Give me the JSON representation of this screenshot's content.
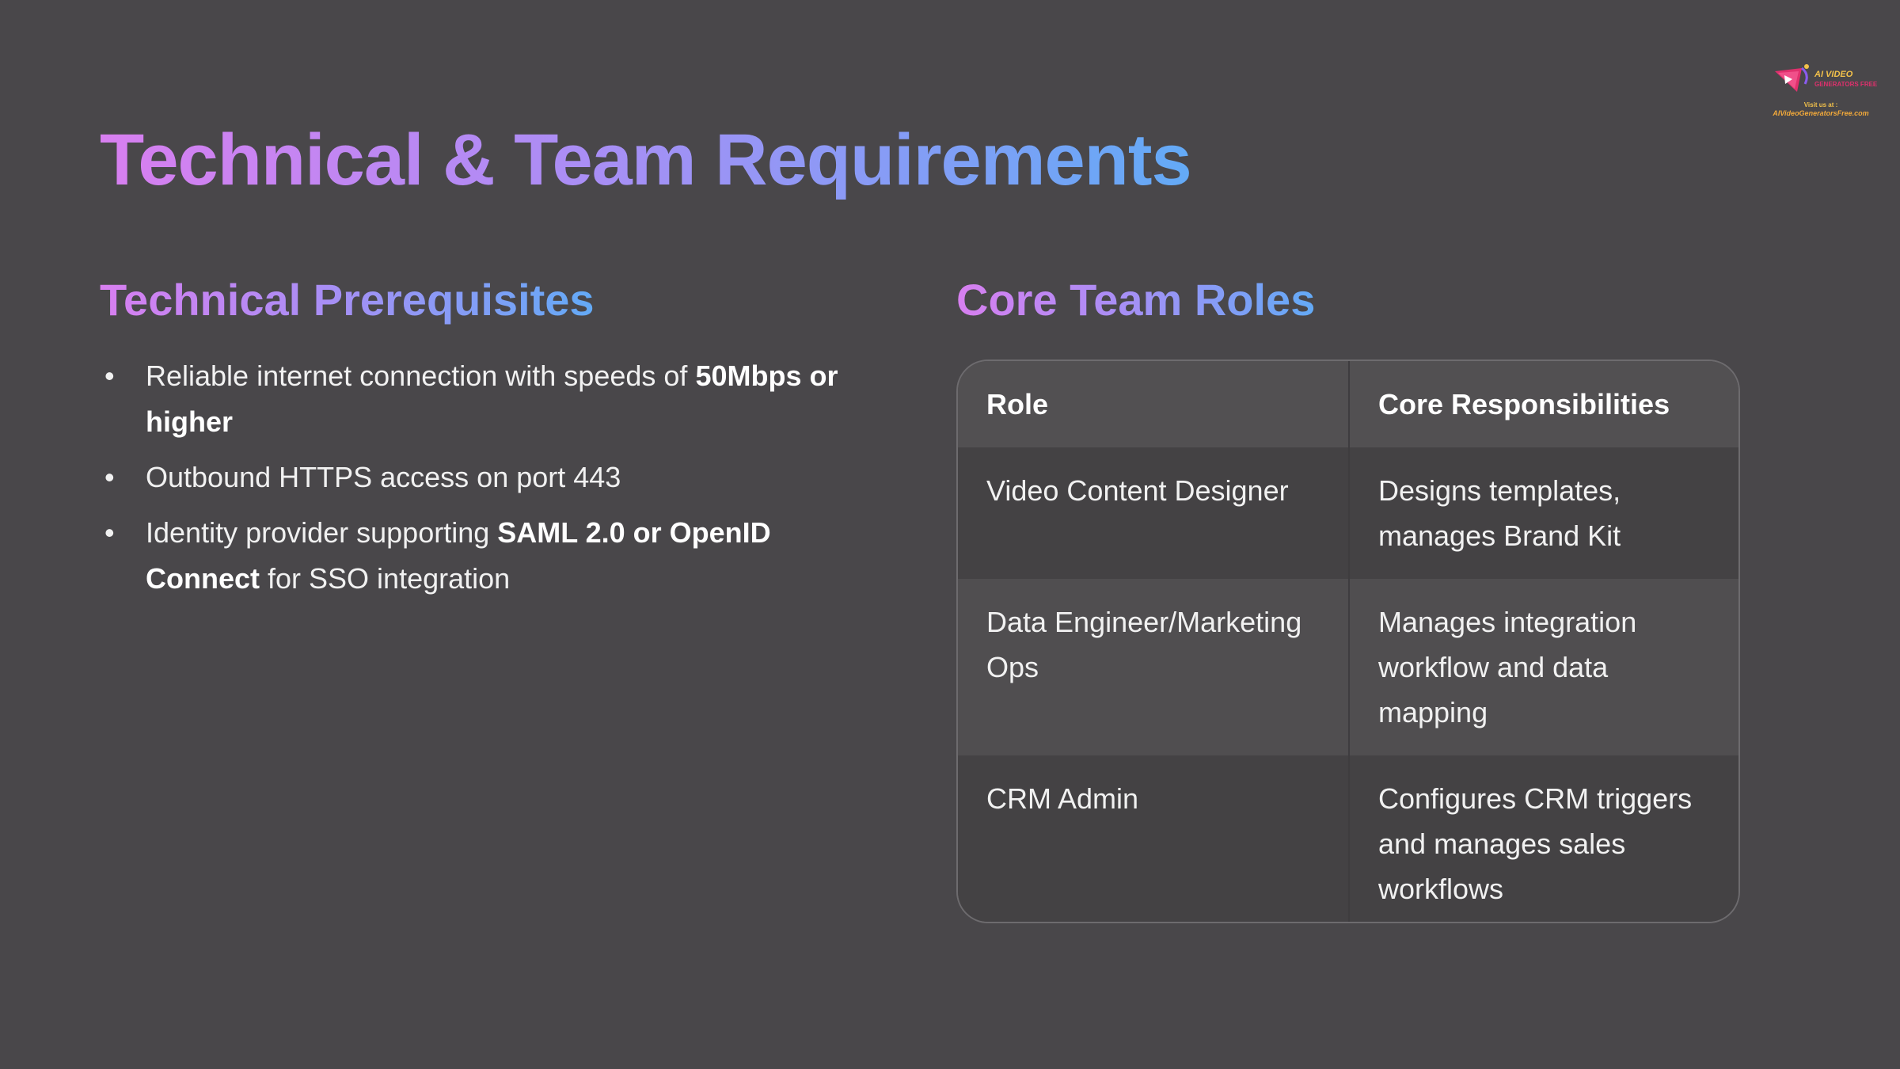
{
  "title": "Technical & Team Requirements",
  "left": {
    "heading": "Technical Prerequisites",
    "items": [
      {
        "text": "Reliable internet connection with speeds of ",
        "bold": "50Mbps or higher",
        "after": ""
      },
      {
        "text": "Outbound HTTPS access on port 443",
        "bold": "",
        "after": ""
      },
      {
        "text": "Identity provider supporting ",
        "bold": "SAML 2.0 or OpenID Connect",
        "after": " for SSO integration"
      }
    ]
  },
  "right": {
    "heading": "Core Team Roles",
    "table": {
      "headers": [
        "Role",
        "Core Responsibilities"
      ],
      "rows": [
        [
          "Video Content Designer",
          "Designs templates, manages Brand Kit"
        ],
        [
          "Data Engineer/Marketing Ops",
          "Manages integration workflow and data mapping"
        ],
        [
          "CRM Admin",
          "Configures CRM triggers and manages sales workflows"
        ]
      ]
    }
  },
  "logo": {
    "name": "AI VIDEO",
    "sub": "GENERATORS FREE",
    "visit": "Visit us at :",
    "url": "AIVideoGeneratorsFree.com"
  },
  "colors": {
    "background": "#49474a",
    "gradient_start": "#d87ff0",
    "gradient_end": "#63aaf6"
  }
}
